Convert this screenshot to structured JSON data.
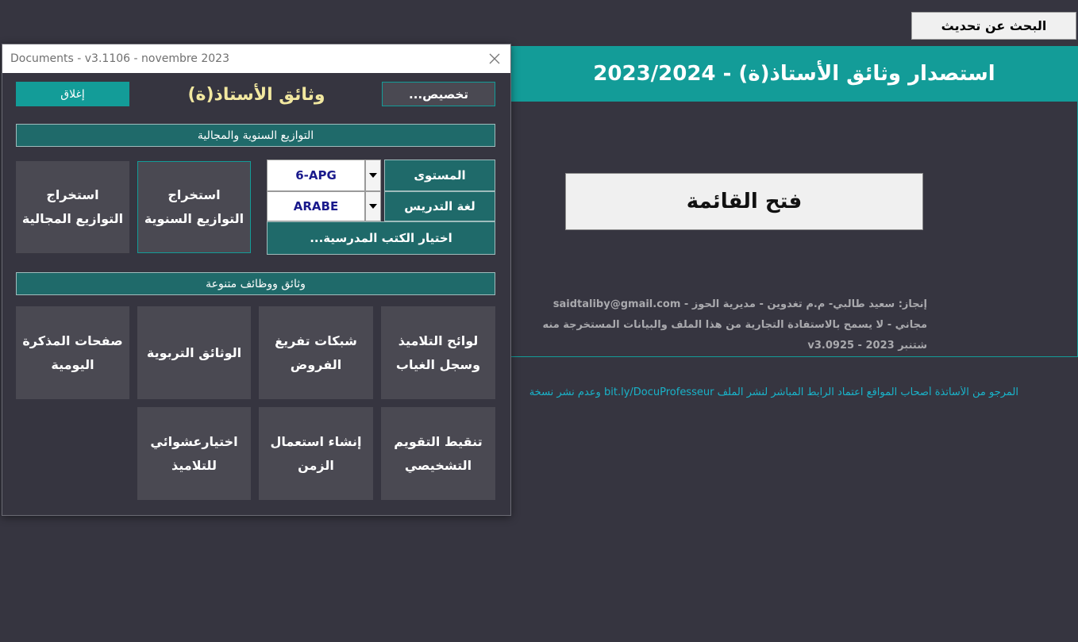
{
  "sheet": {
    "update_button": "البحث عن تحديث",
    "banner_title": "استصدار وثائق الأستاذ(ة) - 2023/2024",
    "open_menu_button": "فتح القائمة",
    "credits": [
      "إنجاز: سعيد طالبي- م.م تغدوين - مديرية الحوز - saidtaliby@gmail.com",
      "مجاني - لا يسمح بالاستفادة التجارية من هذا الملف والبيانات المستخرجة منه",
      "شتنبر 2023 - v3.0925"
    ],
    "footer_note": "المرجو من الأساتذة أصحاب المواقع اعتماد الرابط المباشر لنشر الملف bit.ly/DocuProfesseur وعدم نشر نسخة"
  },
  "dialog": {
    "title": "Documents - v3.1106 - novembre 2023",
    "customize_button": "تخصيص...",
    "heading": "وثائق الأستاذ(ة)",
    "close_button": "إغلاق",
    "section1_title": "التوازيع السنوية والمجالية",
    "level_label": "المستوى",
    "level_value": "6-APG",
    "language_label": "لغة التدريس",
    "language_value": "ARABE",
    "textbooks_button": "اختيار الكتب المدرسية...",
    "annual_button": "استخراج التوازيع السنوية",
    "spatial_button": "استخراج التوازيع المجالية",
    "section2_title": "وثائق ووظائف متنوعة",
    "tiles": {
      "students_lists": "لوائح التلاميذ وسجل الغياب",
      "grading_grids": "شبكات تفريغ الفروض",
      "educational_docs": "الوثائق التربوية",
      "daily_notebook": "صفحات المذكرة اليومية",
      "diagnostic_eval": "تنقيط التقويم التشخيصي",
      "timetable": "إنشاء استعمال الزمن",
      "random_pick": "اختيارعشوائي للتلاميذ"
    }
  }
}
